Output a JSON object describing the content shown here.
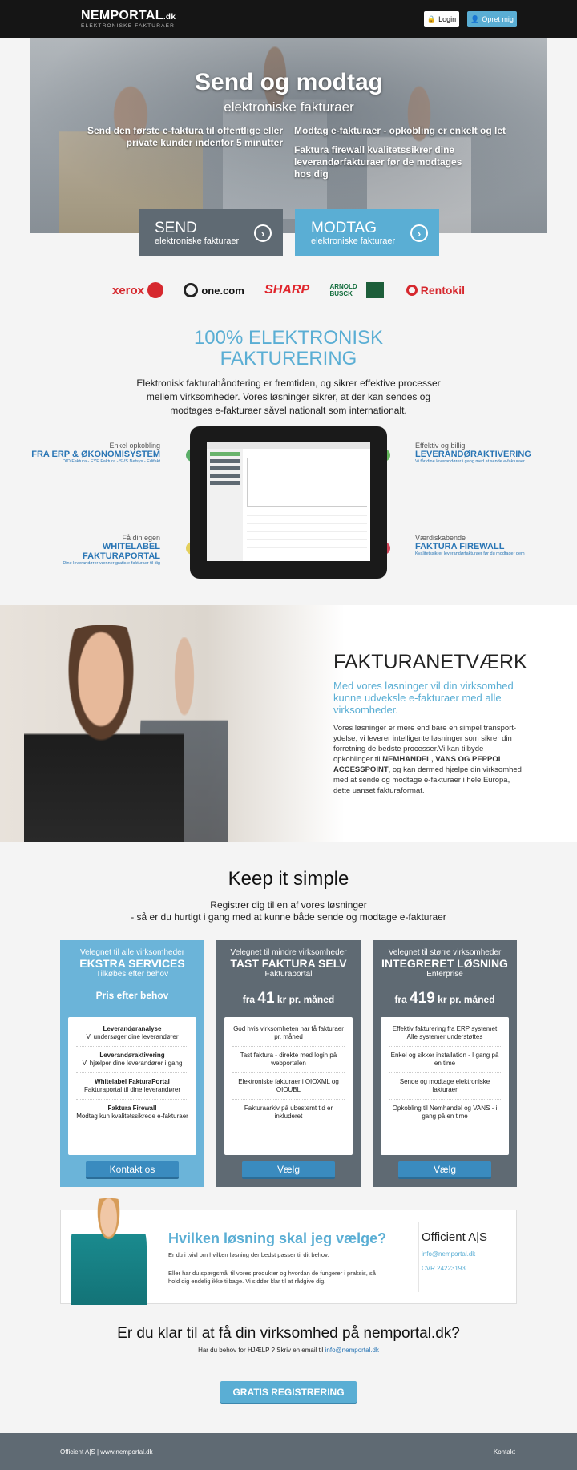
{
  "header": {
    "logo": "NEMPORTAL",
    "logo_dk": ".dk",
    "logo_sub": "ELEKTRONISKE FAKTURAER",
    "login": "Login",
    "opret": "Opret mig"
  },
  "hero": {
    "title": "Send og modtag",
    "subtitle": "elektroniske fakturaer",
    "left_text": "Send den første e-faktura til offentlige eller private kunder indenfor 5 minutter",
    "right_text_1": "Modtag e-fakturaer - opkobling er enkelt og let",
    "right_text_2": "Faktura firewall kvalitetssikrer dine leverandørfakturaer før de modtages hos dig",
    "send_big": "SEND",
    "send_small": "elektroniske fakturaer",
    "modtag_big": "MODTAG",
    "modtag_small": "elektroniske fakturaer"
  },
  "logos": [
    "xerox",
    "one.com",
    "SHARP",
    "ARNOLD BUSCK",
    "Rentokil"
  ],
  "section100": {
    "title_1": "100% ELEKTRONISK",
    "title_2": "FAKTURERING",
    "intro": "Elektronisk fakturahåndtering er fremtiden, og sikrer effektive processer mellem virksomheder. Vores løsninger sikrer, at der kan sendes og modtages e-fakturaer såvel nationalt som internationalt."
  },
  "features": {
    "tl": {
      "t1": "Enkel opkobling",
      "t2": "FRA ERP & ØKONOMISYSTEM",
      "t3": "DIO Faktura - EYE Faktura - SVS Netsys - Edifakt"
    },
    "bl": {
      "t1": "Få din egen",
      "t2": "WHITELABEL FAKTURAPORTAL",
      "t3": "Dine leverandører vænner gratis e-fakturaer til dig"
    },
    "tr": {
      "t1": "Effektiv og billig",
      "t2": "LEVERANDØRAKTIVERING",
      "t3": "Vi får dine leverandører i gang med at sende e-fakturaer"
    },
    "br": {
      "t1": "Værdiskabende",
      "t2": "FAKTURA FIREWALL",
      "t3": "Kvalitetssikrer leverandørfakturaer før du modtager dem"
    }
  },
  "network": {
    "title": "FAKTURANETVÆRK",
    "lead": "Med vores løsninger vil din virksomhed kunne udveksle e-fakturaer med alle virksomheder.",
    "body_1": "Vores løsninger er mere end bare en simpel transport-ydelse, vi leverer intelligente løsninger som sikrer din forretning de bedste processer.Vi kan tilbyde opkoblinger til ",
    "body_bold": "NEMHANDEL, VANS OG PEPPOL ACCESSPOINT",
    "body_2": ", og kan dermed hjælpe din virksomhed med at sende og modtage e-fakturaer i hele Europa, dette uanset fakturaformat."
  },
  "simple": {
    "title": "Keep it simple",
    "sub_1": "Registrer dig til en af vores løsninger",
    "sub_2": "- så er du hurtigt i gang med at kunne både sende og modtage e-fakturaer"
  },
  "cards": [
    {
      "h1": "Velegnet til alle virksomheder",
      "h2": "EKSTRA SERVICES",
      "h3": "Tilkøbes efter behov",
      "price": "Pris efter behov",
      "items": [
        {
          "title": "Leverandøranalyse",
          "text": "Vi undersøger dine leverandører"
        },
        {
          "title": "Leverandøraktivering",
          "text": "Vi hjælper dine leverandører i gang"
        },
        {
          "title": "Whitelabel FakturaPortal",
          "text": "Fakturaportal til dine leverandører"
        },
        {
          "title": "Faktura Firewall",
          "text": "Modtag kun kvalitetssikrede e-fakturaer"
        }
      ],
      "button": "Kontakt os"
    },
    {
      "h1": "Velegnet til mindre virksomheder",
      "h2": "TAST FAKTURA SELV",
      "h3": "Fakturaportal",
      "price_pre": "fra",
      "price_num": "41",
      "price_post": "kr pr. måned",
      "items": [
        "God hvis virksomheten har få fakturaer pr. måned",
        "Tast faktura - direkte med login på webportalen",
        "Elektroniske fakturaer i OIOXML og OIOUBL",
        "Fakturaarkiv på ubestemt tid er inkluderet"
      ],
      "button": "Vælg"
    },
    {
      "h1": "Velegnet til større virksomheder",
      "h2": "INTEGRERET LØSNING",
      "h3": "Enterprise",
      "price_pre": "fra",
      "price_num": "419",
      "price_post": "kr pr. måned",
      "items": [
        "Effektiv fakturering fra ERP systemet Alle systemer understøttes",
        "Enkel og sikker installation - I gang på en time",
        "Sende og modtage elektroniske fakturaer",
        "Opkobling til Nemhandel og VANS - i gang på en time"
      ],
      "button": "Vælg"
    }
  ],
  "help": {
    "title": "Hvilken løsning skal jeg vælge?",
    "p1": "Er du i tvivl om hvilken løsning der bedst passer til dit behov.",
    "p2": "Eller har du spørgsmål til vores produkter og hvordan de fungerer i praksis, så hold dig endelig ikke tilbage. Vi sidder klar til at rådgive dig.",
    "company": "Officient A|S",
    "email": "info@nemportal.dk",
    "cvr": "CVR 24223193"
  },
  "ready": {
    "title": "Er du klar til at få din virksomhed på nemportal.dk?",
    "sub": "Har du behov for HJÆLP ? Skriv en email til ",
    "email": "info@nemportal.dk",
    "button": "GRATIS REGISTRERING"
  },
  "footer": {
    "left": "Officient A|S | www.nemportal.dk",
    "right": "Kontakt"
  },
  "colors": {
    "accent": "#5aaed4",
    "dark": "#5f6a73",
    "topbar": "#151515"
  }
}
